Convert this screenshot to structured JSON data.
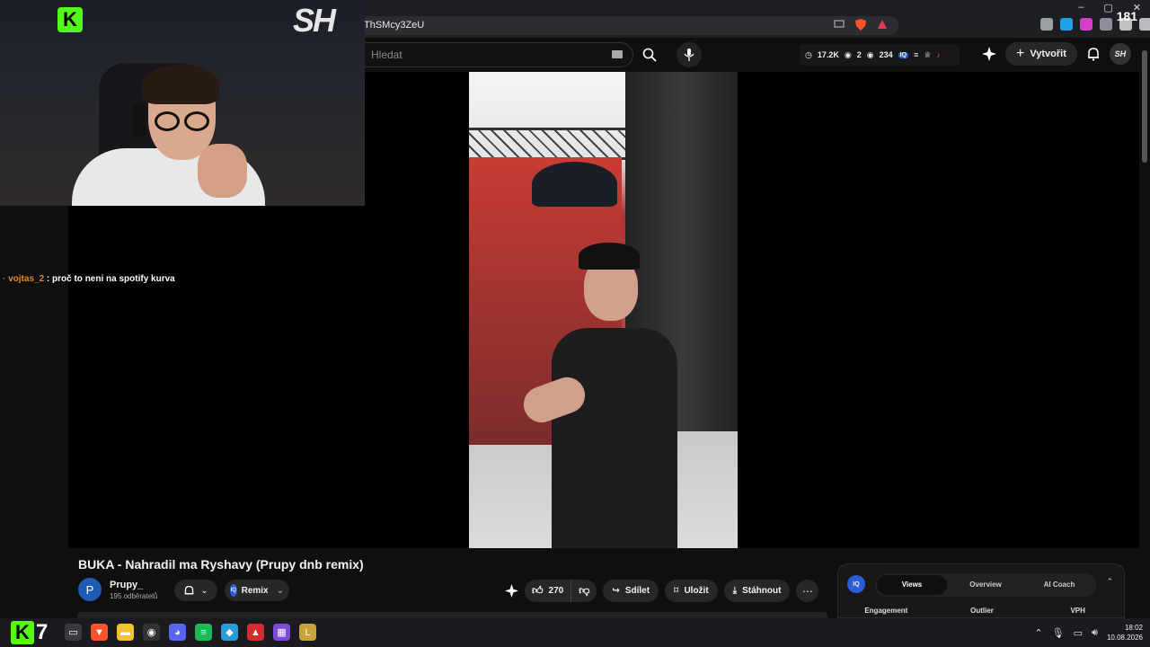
{
  "browser": {
    "url": "ThSMcy3ZeU",
    "win_controls": [
      "–",
      "▢",
      "✕"
    ],
    "counter": "181",
    "ext_colors": [
      "#9aa0a6",
      "#1aa3e8",
      "#d33fc6",
      "#8a8f98",
      "#c0c0c0",
      "#bbbbbb"
    ]
  },
  "webcam": {
    "overlay_logo": "K",
    "overlay_brand": "SH"
  },
  "chat": {
    "username": "vojtas_2",
    "separator": " : ",
    "message": "proč to neni na spotify kurva"
  },
  "youtube_header": {
    "search_placeholder": "Hledat",
    "stats": {
      "views": "17.2K",
      "stat2": "2",
      "stat3": "234"
    },
    "create_label": "Vytvořit",
    "avatar_label": "SH"
  },
  "video": {
    "title": "BUKA - Nahradil ma Ryshavy (Prupy dnb remix)",
    "channel": {
      "avatar_letter": "P",
      "name": "Prupy_",
      "subscribers": "195 odběratelů"
    },
    "remix_label": "Remix",
    "remix_badge": "IQ",
    "likes": "270",
    "share_label": "Sdílet",
    "save_label": "Uložit",
    "download_label": "Stáhnout"
  },
  "panel": {
    "badge": "IQ",
    "tabs": [
      "Views",
      "Overview",
      "AI Coach"
    ],
    "active_tab": 0,
    "columns": [
      "Engagement",
      "Outlier",
      "VPH"
    ]
  },
  "taskbar": {
    "logo": "K",
    "seven": "7",
    "time": "18:02",
    "date": "10.08.2026",
    "apps": [
      {
        "name": "task-view",
        "color": "#3a3a3a",
        "glyph": "▭"
      },
      {
        "name": "brave",
        "color": "#fb542b",
        "glyph": "▼"
      },
      {
        "name": "explorer",
        "color": "#f2c230",
        "glyph": "▬"
      },
      {
        "name": "obs",
        "color": "#333",
        "glyph": "◉"
      },
      {
        "name": "discord",
        "color": "#5865f2",
        "glyph": "◕"
      },
      {
        "name": "spotify",
        "color": "#1db954",
        "glyph": "≡"
      },
      {
        "name": "app-diamond",
        "color": "#2a9bd8",
        "glyph": "◆"
      },
      {
        "name": "app-red",
        "color": "#d22d2d",
        "glyph": "▲"
      },
      {
        "name": "app-grid",
        "color": "#7b4bd6",
        "glyph": "▦"
      },
      {
        "name": "league",
        "color": "#c8a23a",
        "glyph": "L"
      }
    ]
  }
}
